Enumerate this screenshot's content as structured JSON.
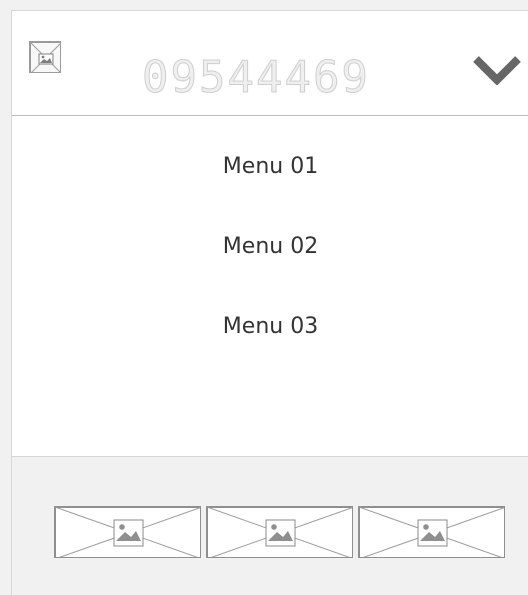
{
  "header": {
    "logo_icon": "image-placeholder-icon",
    "phone_number": "09544469",
    "chevron_icon": "chevron-down-icon"
  },
  "menu": {
    "items": [
      {
        "label": "Menu 01"
      },
      {
        "label": "Menu 02"
      },
      {
        "label": "Menu 03"
      }
    ]
  },
  "footer": {
    "thumbnails": [
      {
        "icon": "image-placeholder-icon"
      },
      {
        "icon": "image-placeholder-icon"
      },
      {
        "icon": "image-placeholder-icon"
      }
    ]
  },
  "colors": {
    "background": "#f1f1f1",
    "panel": "#ffffff",
    "border": "#d7d7d7",
    "text": "#333333",
    "chevron": "#666666"
  }
}
